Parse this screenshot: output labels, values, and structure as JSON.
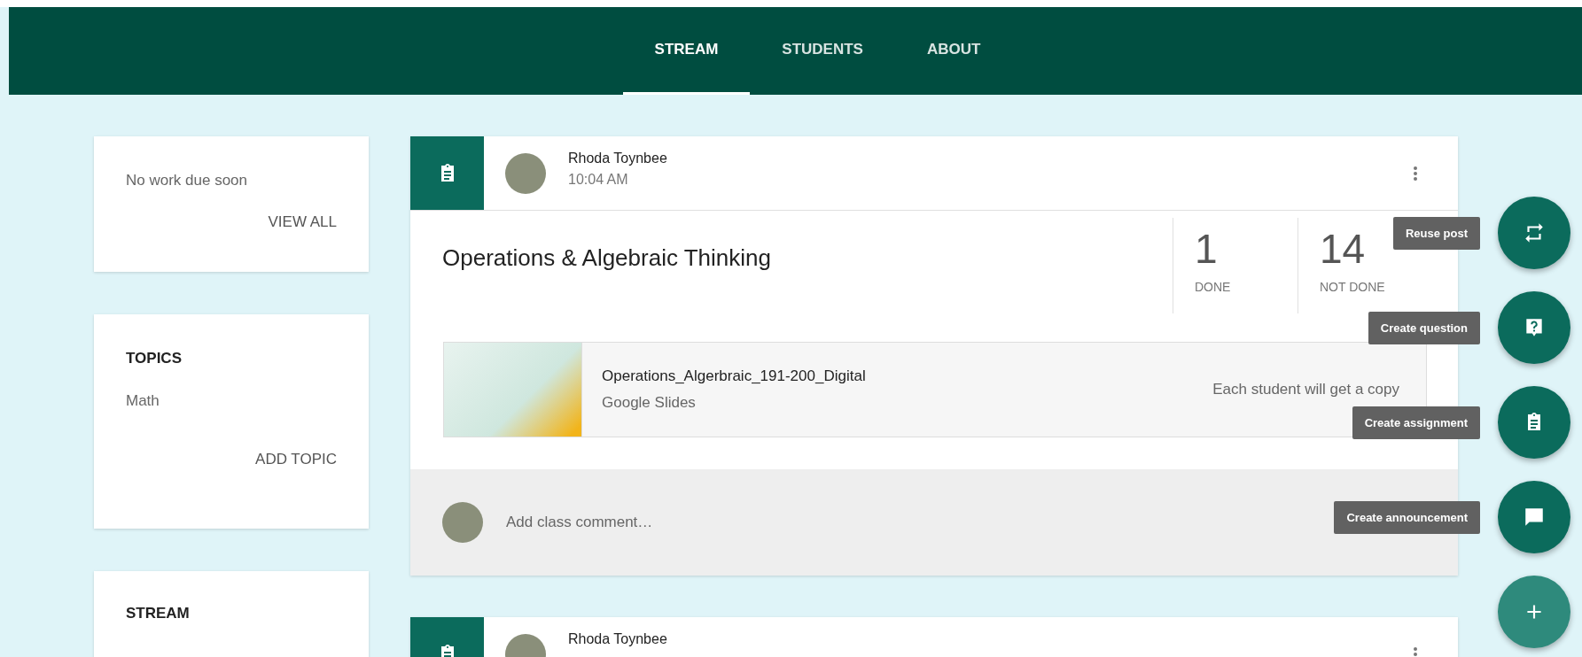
{
  "tabs": [
    {
      "label": "STREAM",
      "selected": true
    },
    {
      "label": "STUDENTS",
      "selected": false
    },
    {
      "label": "ABOUT",
      "selected": false
    }
  ],
  "upcoming": {
    "text": "No work due soon",
    "action": "VIEW ALL"
  },
  "topics": {
    "heading": "TOPICS",
    "items": [
      "Math"
    ],
    "action": "ADD TOPIC"
  },
  "stream_card": {
    "heading": "STREAM"
  },
  "posts": [
    {
      "kind": "assignment",
      "author": "Rhoda Toynbee",
      "time": "10:04 AM",
      "title": "Operations & Algebraic Thinking",
      "stats": [
        {
          "value": "1",
          "label": "DONE"
        },
        {
          "value": "14",
          "label": "NOT DONE"
        }
      ],
      "attachment": {
        "name": "Operations_Algerbraic_191-200_Digital",
        "type": "Google Slides",
        "note": "Each student will get a copy"
      },
      "comment_placeholder": "Add class comment…"
    },
    {
      "kind": "assignment",
      "author": "Rhoda Toynbee"
    }
  ],
  "actions": [
    {
      "kind": "reuse",
      "label": "Reuse post"
    },
    {
      "kind": "question",
      "label": "Create question"
    },
    {
      "kind": "assignment",
      "label": "Create assignment"
    },
    {
      "kind": "announcement",
      "label": "Create announcement"
    },
    {
      "kind": "add"
    }
  ]
}
